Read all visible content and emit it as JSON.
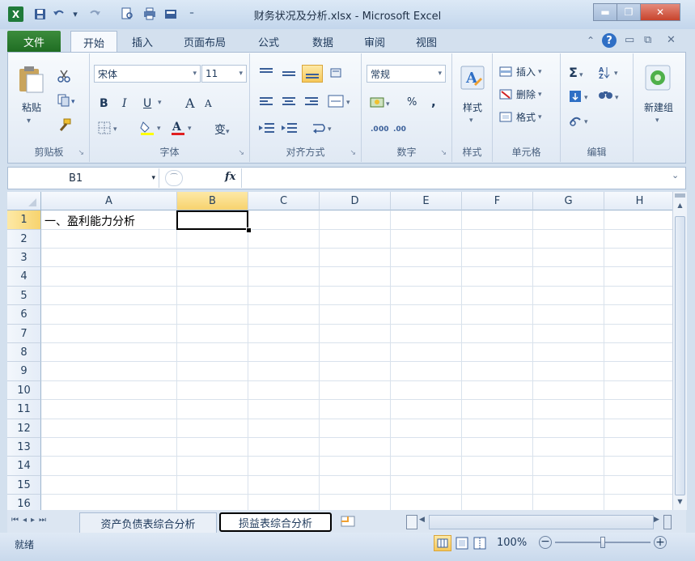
{
  "window": {
    "title": "财务状况及分析.xlsx - Microsoft Excel",
    "app_icon_letter": "X"
  },
  "tabs": {
    "file": "文件",
    "items": [
      "开始",
      "插入",
      "页面布局",
      "公式",
      "数据",
      "审阅",
      "视图"
    ],
    "active": "开始"
  },
  "ribbon": {
    "clipboard": {
      "label": "剪贴板",
      "paste": "粘贴"
    },
    "font": {
      "label": "字体",
      "font_name": "宋体",
      "font_size": "11",
      "bold": "B",
      "italic": "I",
      "underline": "U",
      "grow": "A",
      "shrink": "A",
      "wen": "变"
    },
    "alignment": {
      "label": "对齐方式"
    },
    "number": {
      "label": "数字",
      "format": "常规",
      "percent": "%",
      "comma": ","
    },
    "styles": {
      "label": "样式",
      "button": "样式"
    },
    "cells": {
      "label": "单元格",
      "insert": "插入",
      "delete": "删除",
      "format": "格式"
    },
    "editing": {
      "label": "编辑",
      "sigma": "Σ"
    },
    "newgroup": {
      "label": "新建组"
    }
  },
  "formula_bar": {
    "name_box": "B1",
    "fx": "fx",
    "value": ""
  },
  "grid": {
    "columns": [
      "A",
      "B",
      "C",
      "D",
      "E",
      "F",
      "G",
      "H"
    ],
    "rows": [
      "1",
      "2",
      "3",
      "4",
      "5",
      "6",
      "7",
      "8",
      "9",
      "10",
      "11",
      "12",
      "13",
      "14",
      "15",
      "16"
    ],
    "selected_cell": "B1",
    "cells": {
      "A1": "一、盈利能力分析"
    }
  },
  "sheets": {
    "tabs": [
      "资产负债表综合分析",
      "损益表综合分析"
    ],
    "active": "损益表综合分析"
  },
  "status": {
    "ready": "就绪",
    "zoom": "100%"
  },
  "colors": {
    "accent_green": "#1f6d23",
    "selection_gold": "#f7d36e"
  }
}
